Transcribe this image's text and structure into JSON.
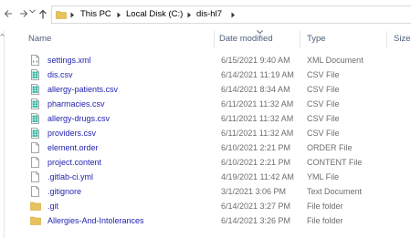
{
  "breadcrumb": {
    "items": [
      "This PC",
      "Local Disk (C:)",
      "dis-hl7"
    ]
  },
  "columns": {
    "name": "Name",
    "date": "Date modified",
    "type": "Type",
    "size": "Size"
  },
  "files": [
    {
      "name": "settings.xml",
      "date": "6/15/2021 9:40 AM",
      "type": "XML Document",
      "icon": "xml-file-icon"
    },
    {
      "name": "dis.csv",
      "date": "6/14/2021 11:19 AM",
      "type": "CSV File",
      "icon": "csv-file-icon"
    },
    {
      "name": "allergy-patients.csv",
      "date": "6/14/2021 8:34 AM",
      "type": "CSV File",
      "icon": "csv-file-icon"
    },
    {
      "name": "pharmacies.csv",
      "date": "6/11/2021 11:32 AM",
      "type": "CSV File",
      "icon": "csv-file-icon"
    },
    {
      "name": "allergy-drugs.csv",
      "date": "6/11/2021 11:32 AM",
      "type": "CSV File",
      "icon": "csv-file-icon"
    },
    {
      "name": "providers.csv",
      "date": "6/11/2021 11:32 AM",
      "type": "CSV File",
      "icon": "csv-file-icon"
    },
    {
      "name": "element.order",
      "date": "6/10/2021 2:21 PM",
      "type": "ORDER File",
      "icon": "generic-file-icon"
    },
    {
      "name": "project.content",
      "date": "6/10/2021 2:21 PM",
      "type": "CONTENT File",
      "icon": "generic-file-icon"
    },
    {
      "name": ".gitlab-ci.yml",
      "date": "4/19/2021 11:42 AM",
      "type": "YML File",
      "icon": "generic-file-icon"
    },
    {
      "name": ".gitignore",
      "date": "3/1/2021 3:06 PM",
      "type": "Text Document",
      "icon": "generic-file-icon"
    },
    {
      "name": ".git",
      "date": "6/14/2021 3:27 PM",
      "type": "File folder",
      "icon": "folder-icon"
    },
    {
      "name": "Allergies-And-Intolerances",
      "date": "6/14/2021 3:26 PM",
      "type": "File folder",
      "icon": "folder-icon"
    }
  ],
  "colors": {
    "link": "#1f1fb0",
    "header": "#4c607a",
    "muted": "#6d6d6d",
    "folder": "#e8c25a"
  }
}
